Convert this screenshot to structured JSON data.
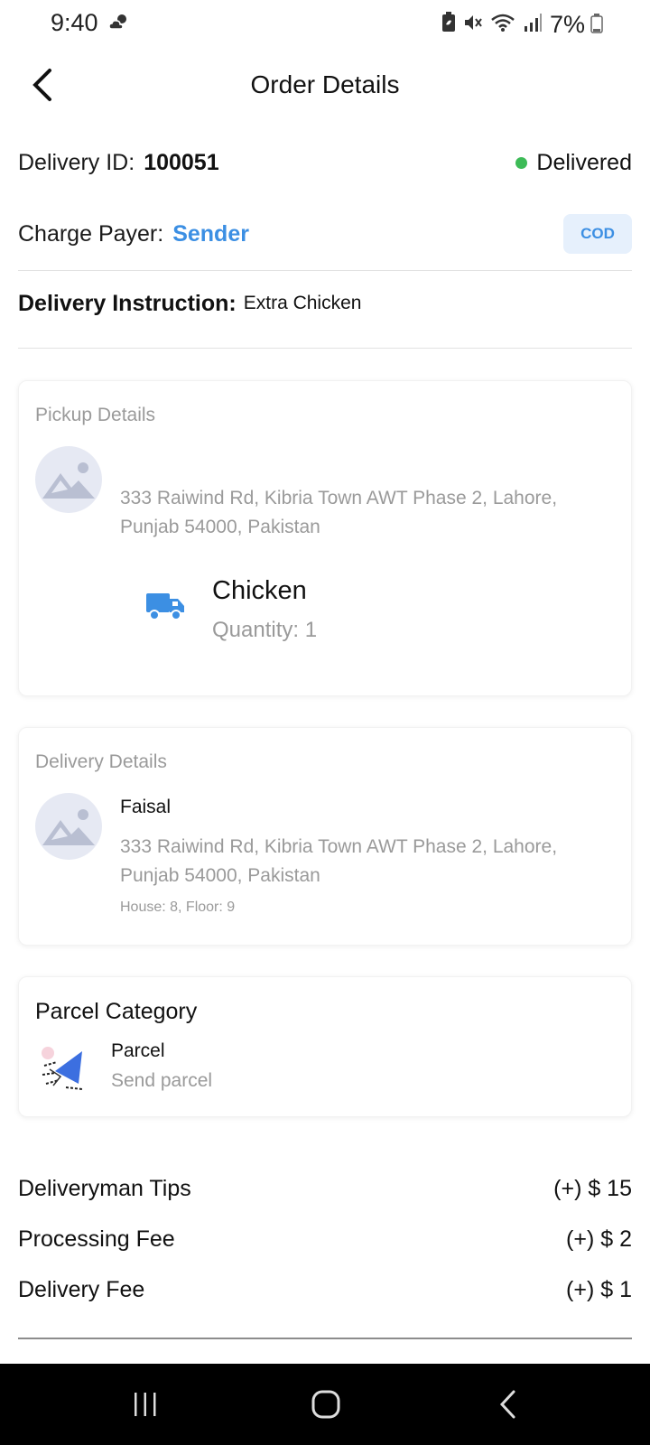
{
  "status_bar": {
    "time": "9:40",
    "battery": "7%",
    "icons": [
      "weather-cloud-sun-icon",
      "battery-saver-icon",
      "mute-icon",
      "wifi-icon",
      "signal-icon",
      "battery-icon"
    ]
  },
  "header": {
    "title": "Order Details",
    "back_icon": "chevron-left-icon"
  },
  "delivery": {
    "id_label": "Delivery ID:",
    "id_value": "100051",
    "status": "Delivered",
    "status_color": "#3dbb57",
    "payer_label": "Charge Payer:",
    "payer_value": "Sender",
    "payment_badge": "COD",
    "instruction_label": "Delivery Instruction:",
    "instruction_value": "Extra Chicken"
  },
  "pickup": {
    "title": "Pickup Details",
    "address": "333 Raiwind Rd, Kibria Town AWT Phase 2, Lahore, Punjab 54000, Pakistan",
    "item_name": "Chicken",
    "item_quantity": "Quantity: 1",
    "item_icon": "truck-icon"
  },
  "delivery_details": {
    "title": "Delivery Details",
    "name": "Faisal",
    "address": "333 Raiwind Rd, Kibria Town AWT Phase 2, Lahore, Punjab 54000, Pakistan",
    "extra": "House: 8, Floor: 9"
  },
  "parcel_category": {
    "title": "Parcel Category",
    "name": "Parcel",
    "description": "Send parcel"
  },
  "fees": [
    {
      "label": "Deliveryman Tips",
      "value": "(+) $ 15"
    },
    {
      "label": "Processing Fee",
      "value": "(+) $ 2"
    },
    {
      "label": "Delivery Fee",
      "value": "(+) $ 1"
    }
  ],
  "colors": {
    "accent": "#3c8fe3",
    "muted": "#9a9a9a",
    "badge_bg": "#e6f0fc"
  },
  "nav": {
    "recents_icon": "recents-icon",
    "home_icon": "home-icon",
    "back_icon": "nav-back-icon"
  }
}
